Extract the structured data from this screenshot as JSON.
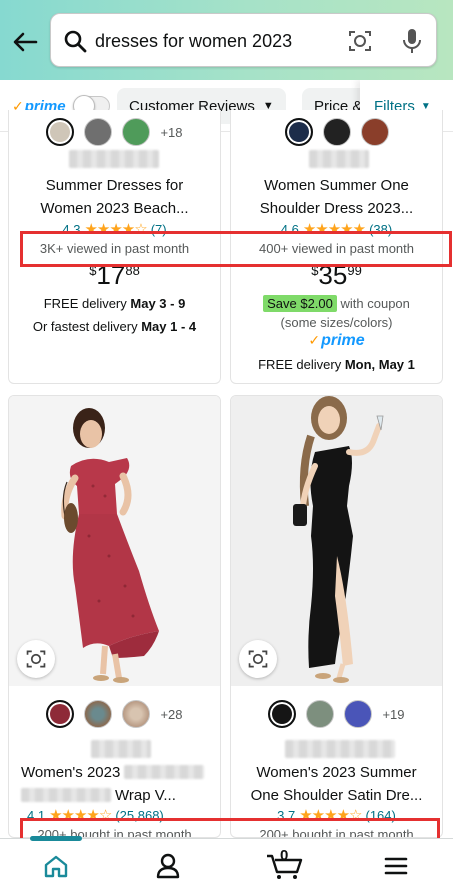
{
  "search": {
    "query": "dresses for women 2023"
  },
  "filterbar": {
    "prime_label": "prime",
    "chips": [
      "Customer Reviews",
      "Price &"
    ],
    "filters_label": "Filters"
  },
  "products": [
    {
      "title_line1": "Summer Dresses for",
      "title_line2": "Women 2023 Beach...",
      "rating": "4.3",
      "reviews": "(7)",
      "social": "3K+ viewed in past month",
      "price_symbol": "$",
      "price_whole": "17",
      "price_fraction": "88",
      "delivery_prefix": "FREE delivery ",
      "delivery_date": "May 3 - 9",
      "fastest_prefix": "Or fastest delivery ",
      "fastest_date": "May 1 - 4",
      "swatches_more": "+18"
    },
    {
      "title_line1": "Women Summer One",
      "title_line2": "Shoulder Dress 2023...",
      "rating": "4.6",
      "reviews": "(38)",
      "social": "400+ viewed in past month",
      "price_symbol": "$",
      "price_whole": "35",
      "price_fraction": "99",
      "coupon_badge": "Save $2.00",
      "coupon_suffix": " with coupon",
      "coupon_note": "(some sizes/colors)",
      "prime": "prime",
      "delivery_prefix": "FREE delivery ",
      "delivery_date": "Mon, May 1"
    },
    {
      "title_line1": "Women's 2023",
      "title_line2": "Wrap V...",
      "rating": "4.1",
      "reviews": "(25,868)",
      "social": "200+ bought in past month",
      "swatches_more": "+28"
    },
    {
      "title_line1": "Women's 2023 Summer",
      "title_line2": "One Shoulder Satin Dre...",
      "rating": "3.7",
      "reviews": "(164)",
      "social": "200+ bought in past month",
      "swatches_more": "+19"
    }
  ],
  "bottom_nav": {
    "cart_count": "0"
  },
  "colors": {
    "accent": "#007185",
    "prime_blue": "#1399ff",
    "star": "#ffa41c",
    "highlight": "#e53030",
    "coupon_green": "#7fda69"
  }
}
